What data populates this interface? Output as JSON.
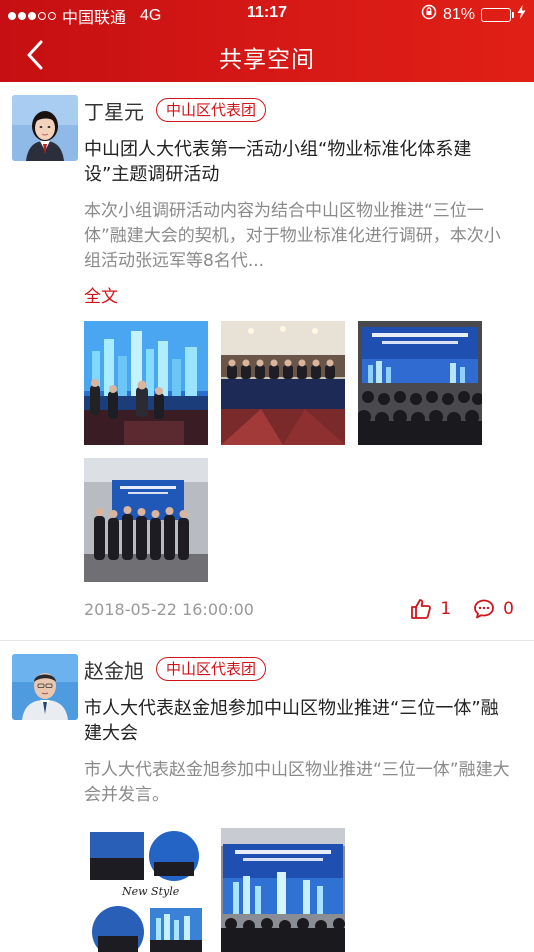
{
  "status_bar": {
    "carrier": "中国联通",
    "network": "4G",
    "time": "11:17",
    "battery": "81%",
    "battery_level": 0.81
  },
  "header": {
    "title": "共享空间"
  },
  "posts": [
    {
      "author": "丁星元",
      "org": "中山区代表团",
      "title": "中山团人大代表第一活动小组“物业标准化体系建设”主题调研活动",
      "summary": "本次小组调研活动内容为结合中山区物业推进“三位一体”融建大会的契机，对于物业标准化进行调研，本次小组活动张远军等8名代...",
      "expand_label": "全文",
      "timestamp": "2018-05-22 16:00:00",
      "likes": "1",
      "comments": "0"
    },
    {
      "author": "赵金旭",
      "org": "中山区代表团",
      "title": "市人大代表赵金旭参加中山区物业推进“三位一体”融建大会",
      "summary": "市人大代表赵金旭参加中山区物业推进“三位一体”融建大会并发言。",
      "photo_caption": "New Style"
    }
  ],
  "colors": {
    "brand_red": "#d0151a",
    "header_red": "#d81a16",
    "battery_green": "#4cd964"
  }
}
